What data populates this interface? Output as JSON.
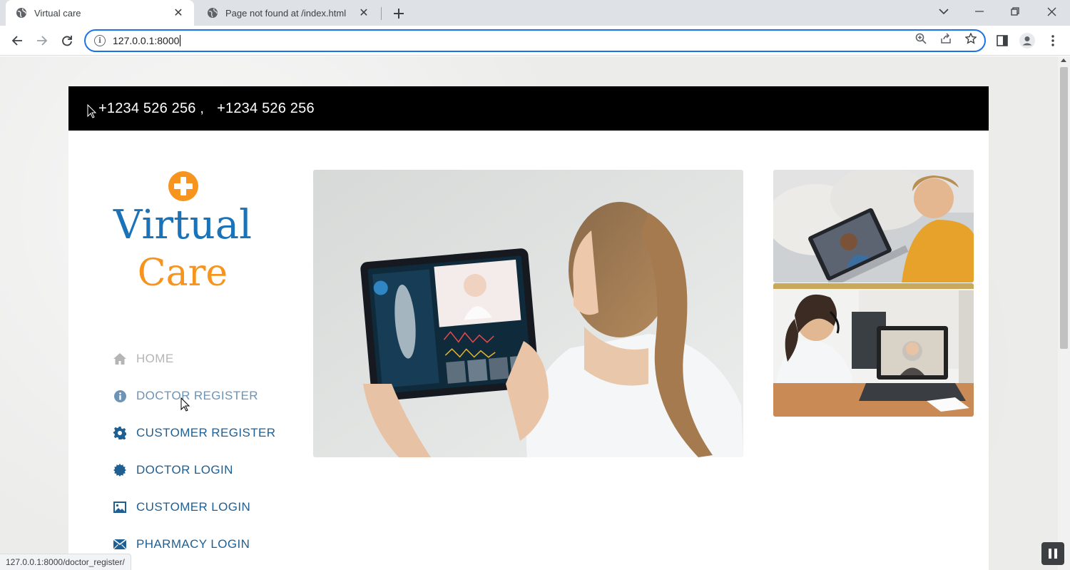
{
  "browser": {
    "tabs": [
      {
        "title": "Virtual care",
        "active": true
      },
      {
        "title": "Page not found at /index.html",
        "active": false
      }
    ],
    "url": "127.0.0.1:8000",
    "status_url": "127.0.0.1:8000/doctor_register/",
    "icons": {
      "tab_favicon": "globe-icon",
      "new_tab": "plus-icon",
      "window": [
        "chevron-down-icon",
        "minimize-icon",
        "restore-icon",
        "close-icon"
      ],
      "nav": [
        "back-icon",
        "forward-icon",
        "reload-icon"
      ],
      "omnibox": [
        "info-icon",
        "zoom-icon",
        "share-icon",
        "star-icon"
      ],
      "toolbar": [
        "side-panel-icon",
        "profile-icon",
        "more-icon"
      ]
    }
  },
  "site": {
    "topbar": {
      "phone_1": "+1234 526 256 ,",
      "phone_2": "+1234 526 256"
    },
    "logo": {
      "line1": "Virtual",
      "line2": "Care",
      "icon": "plus-circle-icon"
    },
    "menu": [
      {
        "label": "HOME",
        "icon": "home-icon"
      },
      {
        "label": "DOCTOR REGISTER",
        "icon": "info-icon"
      },
      {
        "label": "CUSTOMER REGISTER",
        "icon": "gear-icon"
      },
      {
        "label": "DOCTOR LOGIN",
        "icon": "badge-icon"
      },
      {
        "label": "CUSTOMER LOGIN",
        "icon": "image-icon"
      },
      {
        "label": "PHARMACY LOGIN",
        "icon": "envelope-icon"
      }
    ]
  },
  "colors": {
    "brand_blue": "#1a73b8",
    "brand_orange": "#f7941d",
    "menu_blue": "#1f5f92",
    "topbar": "#000000"
  }
}
